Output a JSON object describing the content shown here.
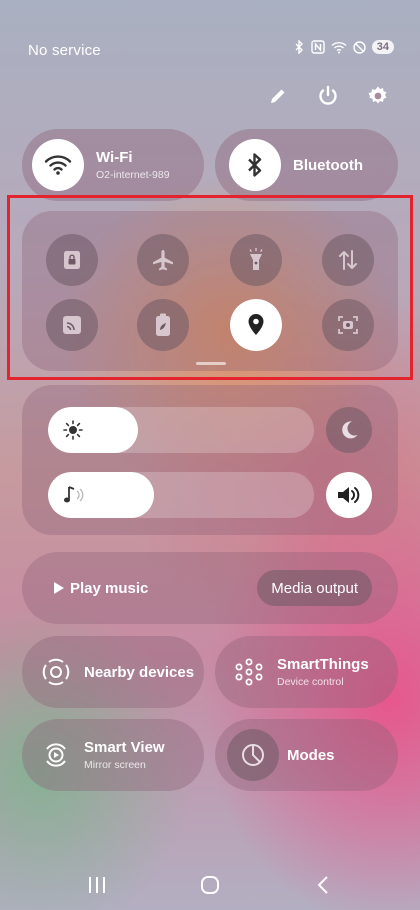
{
  "status_bar": {
    "carrier": "No service",
    "battery": "34",
    "icons": [
      "bluetooth-icon",
      "nfc-icon",
      "wifi-icon",
      "do-not-disturb-icon",
      "battery-icon"
    ]
  },
  "top_actions": [
    "edit-icon",
    "power-icon",
    "settings-icon"
  ],
  "tiles": {
    "wifi": {
      "title": "Wi-Fi",
      "subtitle": "O2-internet-989"
    },
    "bluetooth": {
      "title": "Bluetooth"
    }
  },
  "quick_toggles": [
    {
      "icon": "lock-screen-icon",
      "active": false
    },
    {
      "icon": "airplane-icon",
      "active": false
    },
    {
      "icon": "flashlight-icon",
      "active": false
    },
    {
      "icon": "mobile-data-icon",
      "active": false
    },
    {
      "icon": "cast-icon",
      "active": false
    },
    {
      "icon": "power-saving-icon",
      "active": false
    },
    {
      "icon": "location-icon",
      "active": true
    },
    {
      "icon": "screen-recorder-icon",
      "active": false
    }
  ],
  "brightness": {
    "level": 0.34,
    "icon": "sun-icon",
    "side_icon": "dark-mode-icon"
  },
  "volume": {
    "level": 0.4,
    "icon": "music-note-icon",
    "side_icon": "sound-icon"
  },
  "media": {
    "play_label": "Play music",
    "output_label": "Media output"
  },
  "small_tiles": {
    "nearby": {
      "title": "Nearby devices"
    },
    "smartthings": {
      "title": "SmartThings",
      "subtitle": "Device control"
    },
    "smartview": {
      "title": "Smart View",
      "subtitle": "Mirror screen"
    },
    "modes": {
      "title": "Modes"
    }
  },
  "nav": [
    "recents-icon",
    "home-icon",
    "back-icon"
  ],
  "colors": {
    "highlight_border": "#e3242e",
    "active_toggle": "#ffffff"
  }
}
